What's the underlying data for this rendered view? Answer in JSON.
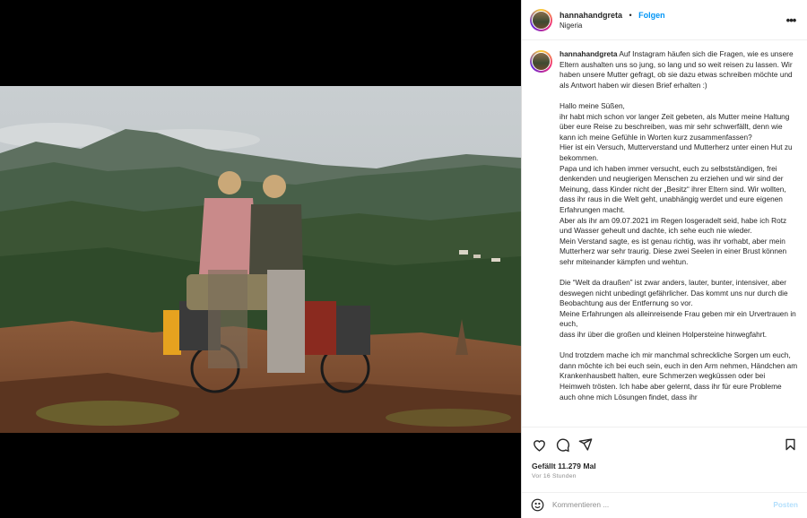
{
  "post": {
    "username": "hannahandgreta",
    "follow_label": "Folgen",
    "separator": "•",
    "location": "Nigeria",
    "more_icon": "more-horizontal-icon"
  },
  "caption": {
    "username": "hannahandgreta",
    "text": " Auf Instagram häufen sich die Fragen, wie es unsere Eltern aushalten uns so jung, so lang und so weit reisen zu lassen. Wir haben unsere Mutter gefragt, ob sie dazu etwas schreiben möchte und als Antwort haben wir diesen Brief erhalten :)\n\nHallo meine Süßen,\nihr habt mich schon vor langer Zeit gebeten, als Mutter meine Haltung über eure Reise zu beschreiben, was mir sehr schwerfällt, denn wie kann ich meine Gefühle in Worten kurz zusammenfassen?\nHier ist ein Versuch, Mutterverstand und Mutterherz unter einen Hut zu bekommen.\nPapa und ich haben immer versucht, euch zu selbstständigen, frei denkenden und neugierigen Menschen zu erziehen und wir sind der Meinung, dass Kinder nicht der „Besitz“ ihrer Eltern sind. Wir wollten, dass ihr raus in die Welt geht, unabhängig werdet und eure eigenen Erfahrungen macht.\nAber als ihr am 09.07.2021 im Regen losgeradelt seid, habe ich Rotz und Wasser geheult und dachte, ich sehe euch nie wieder.\nMein Verstand sagte, es ist genau richtig, was ihr vorhabt, aber mein Mutterherz war sehr traurig. Diese zwei Seelen in einer Brust können sehr miteinander kämpfen und wehtun.\n\nDie “Welt da draußen” ist zwar anders, lauter, bunter, intensiver, aber deswegen nicht unbedingt gefährlicher. Das kommt uns nur durch die Beobachtung aus der Entfernung so vor.\nMeine Erfahrungen als alleinreisende Frau geben mir ein Urvertrauen in euch,\ndass ihr über die großen und kleinen Holpersteine hinwegfahrt.\n\nUnd trotzdem mache ich mir manchmal schreckliche Sorgen um euch, dann möchte ich bei euch sein, euch in den Arm nehmen, Händchen am Krankenhausbett halten, eure Schmerzen wegküssen oder bei Heimweh trösten. Ich habe aber gelernt, dass ihr für eure Probleme auch ohne mich Lösungen findet, dass ihr"
  },
  "actions": {
    "like_icon": "heart-icon",
    "comment_icon": "comment-icon",
    "share_icon": "send-icon",
    "save_icon": "bookmark-icon"
  },
  "likes": "Gefällt 11.279 Mal",
  "time_ago": "Vor 16 Stunden",
  "comment": {
    "emoji_icon": "emoji-icon",
    "placeholder": "Kommentieren ...",
    "post_label": "Posten"
  },
  "colors": {
    "accent": "#0095f6",
    "post_disabled": "#b3dffc",
    "text": "#262626",
    "secondary": "#8e8e8e"
  }
}
